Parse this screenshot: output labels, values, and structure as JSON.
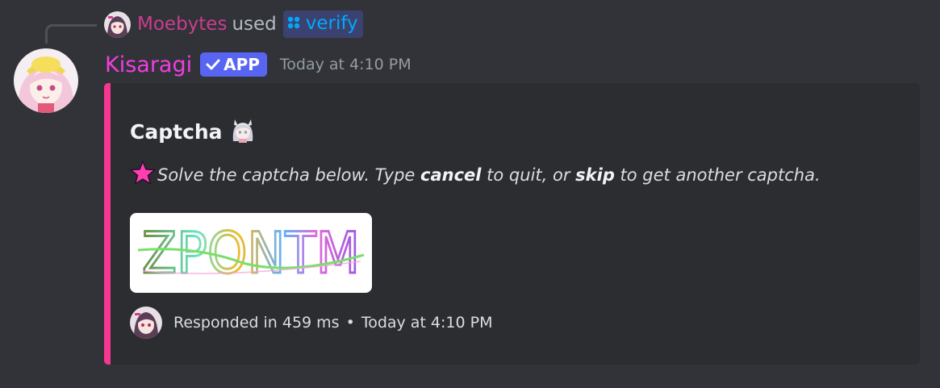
{
  "reply": {
    "user": "Moebytes",
    "verb": "used",
    "command": "verify"
  },
  "author": {
    "name": "Kisaragi",
    "badge": "APP",
    "timestamp": "Today at 4:10 PM"
  },
  "embed": {
    "accent_color": "#f6368f",
    "title": "Captcha",
    "description": {
      "parts": [
        {
          "text": "Solve the captcha below. Type ",
          "bold": false
        },
        {
          "text": "cancel",
          "bold": true
        },
        {
          "text": " to quit, or ",
          "bold": false
        },
        {
          "text": "skip",
          "bold": true
        },
        {
          "text": " to get another captcha.",
          "bold": false
        }
      ]
    },
    "captcha_text": "ZPONTM",
    "footer": {
      "response": "Responded in 459 ms",
      "separator": "•",
      "time": "Today at 4:10 PM"
    }
  },
  "colors": {
    "background": "#313338",
    "embed_background": "#2b2d31",
    "username": "#f23ee0",
    "reply_user": "#cc3c8f",
    "badge": "#5865f2",
    "command_link": "#00a8fc"
  },
  "icons": {
    "command": "slash-command-icon",
    "badge_check": "checkmark-icon",
    "title_emoji": "anime-girl-emoji-icon",
    "description_emoji": "pink-star-icon"
  }
}
